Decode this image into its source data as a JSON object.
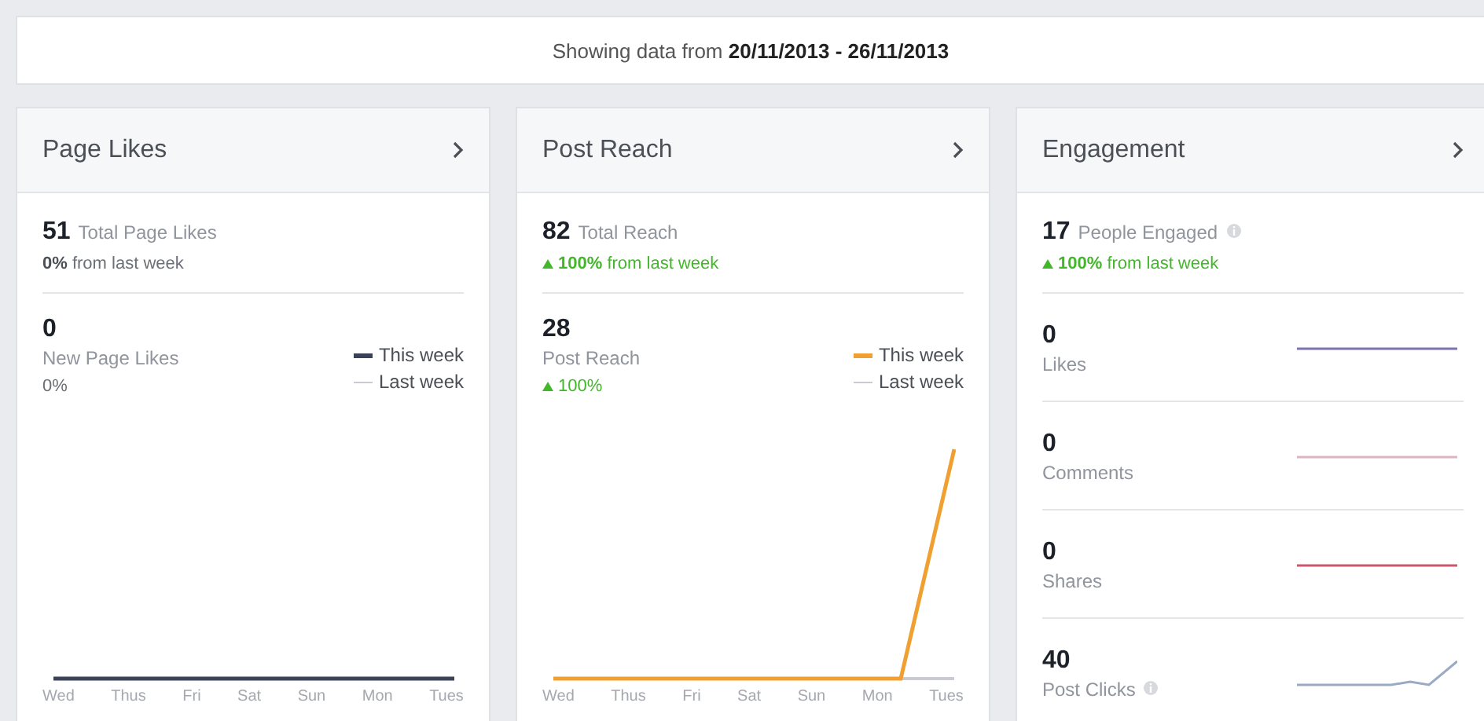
{
  "date_range": {
    "text": "Showing data from **20/11/2013 - 26/11/2013**"
  },
  "cards": [
    {
      "title": "Page Likes",
      "total": {
        "value": "51",
        "label": "Total Page Likes",
        "rising": false,
        "change": "**0%** from last week"
      },
      "metric": {
        "value": "0",
        "label": "New Page Likes",
        "rising": false,
        "change": "0%"
      },
      "chart": {
        "kind": "flat",
        "days": [
          "Wed",
          "Thus",
          "Fri",
          "Sat",
          "Sun",
          "Mon",
          "Tues"
        ],
        "legend": [
          {
            "label": "This week",
            "color": "#3b4258"
          },
          {
            "label": "Last week",
            "color": "#c8ccd2"
          }
        ]
      }
    },
    {
      "title": "Post Reach",
      "total": {
        "value": "82",
        "label": "Total Reach",
        "rising": true,
        "change": "**100%** from last week"
      },
      "metric": {
        "value": "28",
        "label": "Post Reach",
        "rising": true,
        "change": "100%"
      },
      "chart": {
        "kind": "spike",
        "days": [
          "Wed",
          "Thus",
          "Fri",
          "Sat",
          "Sun",
          "Mon",
          "Tues"
        ],
        "legend": [
          {
            "label": "This week",
            "color": "#f0a030"
          },
          {
            "label": "Last week",
            "color": "#c8ccd2"
          }
        ]
      }
    },
    {
      "title": "Engagement",
      "total": {
        "value": "17",
        "label": "People Engaged",
        "info": true,
        "rising": true,
        "change": "**100%** from last week"
      },
      "rows": [
        {
          "value": "0",
          "label": "Likes",
          "kind": "flat",
          "color": "#7f72b0"
        },
        {
          "value": "0",
          "label": "Comments",
          "kind": "flat",
          "color": "#dcb4c2"
        },
        {
          "value": "0",
          "label": "Shares",
          "kind": "flat",
          "color": "#c9586f"
        },
        {
          "value": "40",
          "label": "Post Clicks",
          "info": true,
          "kind": "rise",
          "color": "#9aaac4"
        }
      ]
    }
  ]
}
